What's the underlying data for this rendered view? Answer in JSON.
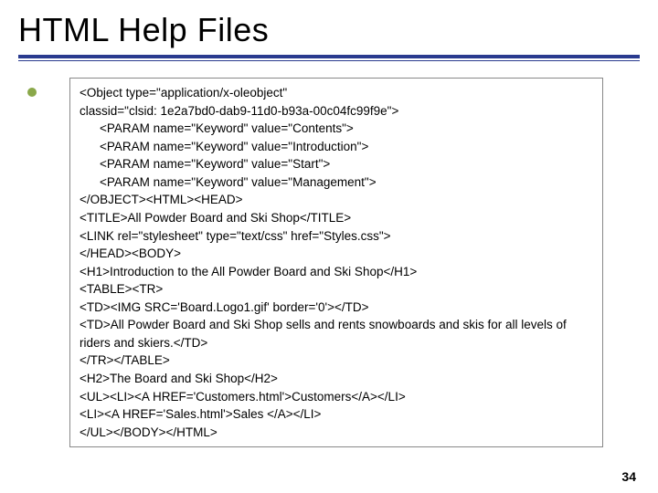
{
  "title": "HTML Help Files",
  "page_number": "34",
  "code": {
    "l01": "<Object type=\"application/x-oleobject\"",
    "l02": "classid=\"clsid: 1e2a7bd0-dab9-11d0-b93a-00c04fc99f9e\">",
    "l03": "<PARAM name=\"Keyword\" value=\"Contents\">",
    "l04": "<PARAM name=\"Keyword\" value=\"Introduction\">",
    "l05": "<PARAM name=\"Keyword\" value=\"Start\">",
    "l06": "<PARAM name=\"Keyword\" value=\"Management\">",
    "l07": "</OBJECT><HTML><HEAD>",
    "l08": "<TITLE>All Powder Board and Ski Shop</TITLE>",
    "l09": "<LINK rel=\"stylesheet\" type=\"text/css\" href=\"Styles.css\">",
    "l10": "</HEAD><BODY>",
    "l11": "<H1>Introduction to the All Powder Board and Ski Shop</H1>",
    "l12": "<TABLE><TR>",
    "l13": "<TD><IMG SRC='Board.Logo1.gif' border='0'></TD>",
    "l14": "<TD>All Powder Board and Ski Shop sells and rents snowboards and skis for all levels of riders and skiers.</TD>",
    "l15": "</TR></TABLE>",
    "l16": "<H2>The Board and Ski Shop</H2>",
    "l17": "<UL><LI><A HREF='Customers.html'>Customers</A></LI>",
    "l18": "<LI><A HREF='Sales.html'>Sales </A></LI>",
    "l19": "</UL></BODY></HTML>"
  }
}
